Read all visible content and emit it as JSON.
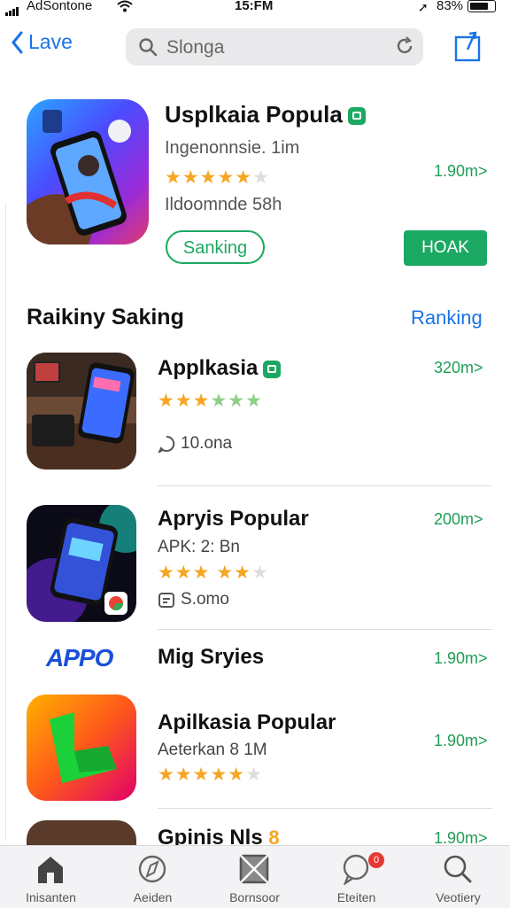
{
  "status": {
    "carrier": "AdSontone",
    "time": "15:FM",
    "battery": "83%"
  },
  "nav": {
    "back_label": "Lave",
    "search_value": "Slonga"
  },
  "featured": {
    "title": "Usplkaia Popula",
    "line1": "Ingenonnsie. 1im",
    "rating": 4,
    "line2": "Ildoomnde 58h",
    "price": "1.90m>",
    "secondary_button": "Sanking",
    "primary_button": "HOAK"
  },
  "section": {
    "title": "Raikiny Saking",
    "link": "Ranking"
  },
  "apps": [
    {
      "name": "Applkasia",
      "price": "320m>",
      "rating": 3.5,
      "meta": "10.ona"
    },
    {
      "name": "Apryis Popular",
      "price": "200m>",
      "subtitle": "APK: 2: Bn",
      "rating": 3.5,
      "meta": "S.omo"
    },
    {
      "name": "Mig Sryies",
      "price": "1.90m>",
      "logo_text": "APPO"
    },
    {
      "name": "Apilkasia Popular",
      "price": "1.90m>",
      "subtitle": "Aeterkan 8 1M",
      "rating": 4.5
    },
    {
      "name": "Gpinis Nls",
      "price": "1.90m>",
      "badge": "8"
    }
  ],
  "tabs": [
    {
      "label": "Inisanten",
      "icon": "home-icon"
    },
    {
      "label": "Aeiden",
      "icon": "compass-icon"
    },
    {
      "label": "Bornsoor",
      "icon": "box-icon"
    },
    {
      "label": "Eteiten",
      "icon": "chat-icon",
      "badge": "0"
    },
    {
      "label": "Veotiery",
      "icon": "search-icon"
    }
  ],
  "colors": {
    "accent": "#1a73e8",
    "green": "#1ba862",
    "star": "#f5a623"
  }
}
